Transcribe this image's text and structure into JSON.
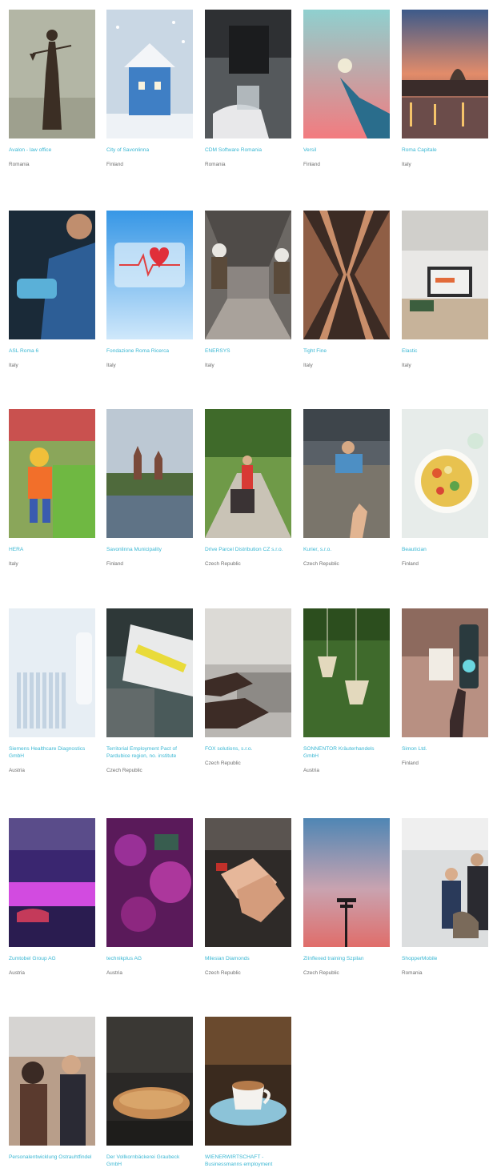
{
  "colors": {
    "link": "#3ab7d3",
    "country": "#6e6e6e",
    "background": "#ffffff"
  },
  "cards": [
    {
      "title": "Avalon - law office",
      "country": "Romania",
      "image": "lady-justice-statue"
    },
    {
      "title": "City of Savonlinna",
      "country": "Finland",
      "image": "snowy-blue-house"
    },
    {
      "title": "CDM Software Romania",
      "country": "Romania",
      "image": "laboratory-gloved-hands"
    },
    {
      "title": "Versil",
      "country": "Finland",
      "image": "lightbulb-sunset-sky"
    },
    {
      "title": "Roma Capitale",
      "country": "Italy",
      "image": "rome-night-river"
    },
    {
      "title": "ASL Roma 6",
      "country": "Italy",
      "image": "worker-with-visor"
    },
    {
      "title": "Fondazione Roma Ricerca",
      "country": "Italy",
      "image": "heartbeat-card"
    },
    {
      "title": "ENERSYS",
      "country": "Italy",
      "image": "workers-in-tunnel"
    },
    {
      "title": "Tight Fine",
      "country": "Italy",
      "image": "mirrored-pillars"
    },
    {
      "title": "Elastic",
      "country": "Italy",
      "image": "laptop-office"
    },
    {
      "title": "HERA",
      "country": "Italy",
      "image": "toy-figure-recycling-bin"
    },
    {
      "title": "Savonlinna Municipality",
      "country": "Finland",
      "image": "lake-town-church"
    },
    {
      "title": "Drive Parcel Distribution CZ s.r.o.",
      "country": "Czech Republic",
      "image": "courier-with-cart"
    },
    {
      "title": "Kurier, s.r.o.",
      "country": "Czech Republic",
      "image": "reaching-hands"
    },
    {
      "title": "Beautician",
      "country": "Finland",
      "image": "salad-bowl"
    },
    {
      "title": "Siemens Healthcare Diagnostics GmbH",
      "country": "Austria",
      "image": "lab-test-tubes"
    },
    {
      "title": "Territorial Employment Pact of Pardubice region, no. institute",
      "country": "Czech Republic",
      "image": "desk-documents"
    },
    {
      "title": "FOX solutions, s.r.o.",
      "country": "Czech Republic",
      "image": "hands-on-keyboard"
    },
    {
      "title": "SONNENTOR Kräuterhandels GmbH",
      "country": "Austria",
      "image": "tea-bags"
    },
    {
      "title": "Simon Ltd.",
      "country": "Finland",
      "image": "traffic-light-sign"
    },
    {
      "title": "Zumtobel Group AG",
      "country": "Austria",
      "image": "purple-lit-lobby"
    },
    {
      "title": "technikplus AG",
      "country": "Austria",
      "image": "magenta-lights"
    },
    {
      "title": "Milesian Diamonds",
      "country": "Czech Republic",
      "image": "holding-hands"
    },
    {
      "title": "Zlínflexed training Szpilan",
      "country": "Czech Republic",
      "image": "signpost-sunset"
    },
    {
      "title": "ShopperMobile",
      "country": "Romania",
      "image": "airport-staff"
    },
    {
      "title": "Personalentwicklung Ostrauhtfindel",
      "country": "",
      "image": "group-of-people"
    },
    {
      "title": "Der Vollkornbäckerei Graubeck GmbH",
      "country": "",
      "image": "bread-loaf"
    },
    {
      "title": "WIENERWIRTSCHAFT - Businessmanns employment",
      "country": "",
      "image": "coffee-cup"
    }
  ]
}
